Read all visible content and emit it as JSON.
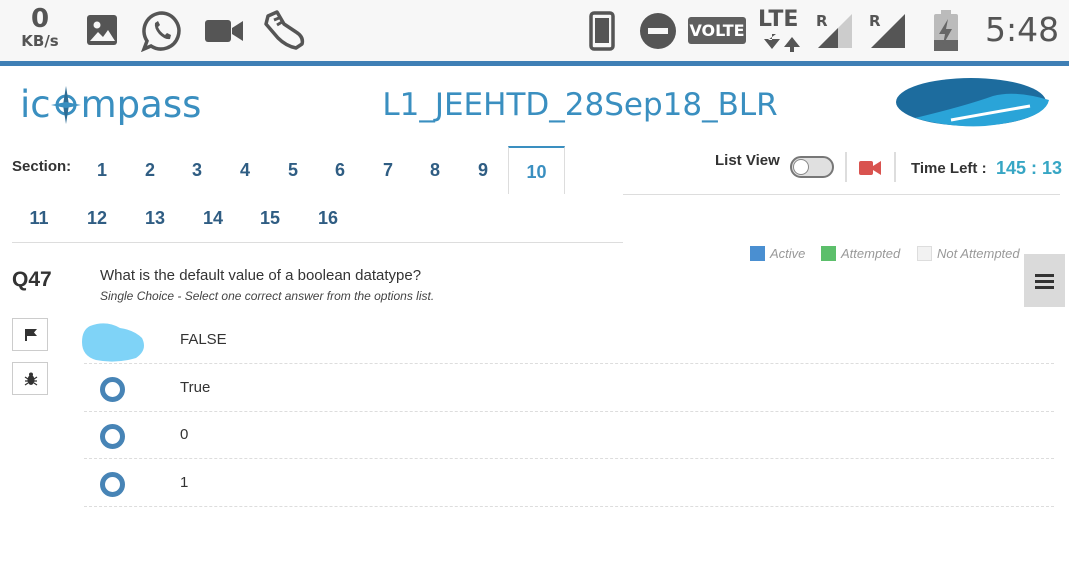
{
  "status_bar": {
    "data_speed_value": "0",
    "data_speed_unit": "KB/s",
    "volte": "VOLTE",
    "network": "LTE",
    "roaming_1": "R",
    "roaming_2": "R",
    "time": "5:48",
    "icons": [
      "image-icon",
      "whatsapp-icon",
      "video-camera-icon",
      "running-shoe-icon",
      "phone-icon",
      "do-not-disturb-icon",
      "signal-icon",
      "battery-charging-icon"
    ]
  },
  "header": {
    "logo_text_before": "ic",
    "logo_text_after": "mpass",
    "exam_title": "L1_JEEHTD_28Sep18_BLR"
  },
  "sections": {
    "label": "Section:",
    "tabs": [
      "1",
      "2",
      "3",
      "4",
      "5",
      "6",
      "7",
      "8",
      "9",
      "10",
      "11",
      "12",
      "13",
      "14",
      "15",
      "16"
    ],
    "active": "10"
  },
  "toolbar": {
    "list_view_label": "List View",
    "list_view_on": false,
    "time_left_label": "Time Left :",
    "time_left_value": "145 : 13"
  },
  "legend": [
    {
      "label": "Active",
      "color": "#4a8fd1"
    },
    {
      "label": "Attempted",
      "color": "#5cbf6b"
    },
    {
      "label": "Not Attempted",
      "color": "#f2f2f2"
    }
  ],
  "question": {
    "number": "Q47",
    "text": "What is the default value of a boolean datatype?",
    "hint": "Single Choice - Select one correct answer from the options list.",
    "options": [
      {
        "label": "FALSE",
        "selected": true
      },
      {
        "label": "True",
        "selected": false
      },
      {
        "label": "0",
        "selected": false
      },
      {
        "label": "1",
        "selected": false
      }
    ]
  },
  "colors": {
    "accent": "#3a8fc0",
    "timer": "#37a6c4",
    "radio": "#4784b6",
    "selected_blob": "#7fd3f7",
    "camera": "#d9534f"
  }
}
